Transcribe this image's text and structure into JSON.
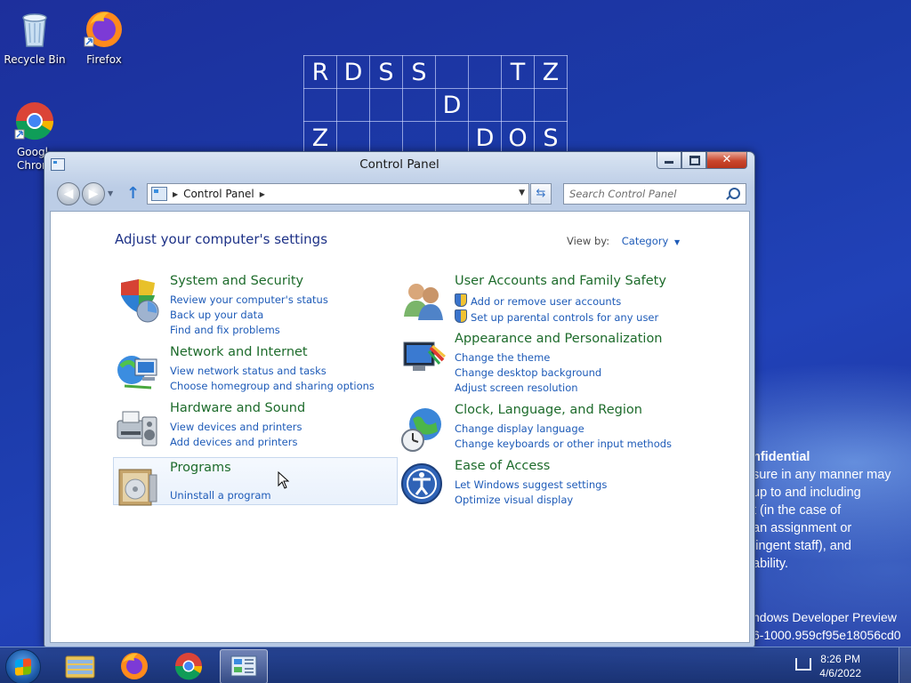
{
  "desktop": {
    "icons": [
      {
        "label": "Recycle Bin",
        "icon": "recycle-bin-icon"
      },
      {
        "label": "Firefox",
        "icon": "firefox-icon"
      },
      {
        "label": "Googl",
        "label2": "Chron",
        "icon": "chrome-icon"
      }
    ],
    "grid_rows": [
      [
        "R",
        "D",
        "S",
        "S",
        "",
        "",
        "T",
        "Z"
      ],
      [
        "",
        "",
        "",
        "",
        "D",
        "",
        "",
        ""
      ],
      [
        "Z",
        "",
        "",
        "",
        "",
        "D",
        "O",
        "S"
      ]
    ],
    "overlay": {
      "title": "nfidential",
      "lines": [
        "sure in any manner may",
        "up to and including",
        "t (in the case of",
        "an assignment or",
        "lingent staff), and",
        "ability."
      ],
      "build1": "ndows Developer Preview",
      "build2": "6-1000.959cf95e18056cd0"
    }
  },
  "window": {
    "title": "Control Panel",
    "address_crumb": "Control Panel",
    "search_placeholder": "Search Control Panel",
    "heading": "Adjust your computer's settings",
    "view_by_label": "View by:",
    "view_by_value": "Category",
    "categories": [
      {
        "title": "System and Security",
        "icon": "system-security-icon",
        "links": [
          "Review your computer's status",
          "Back up your data",
          "Find and fix problems"
        ]
      },
      {
        "title": "Network and Internet",
        "icon": "network-internet-icon",
        "links": [
          "View network status and tasks",
          "Choose homegroup and sharing options"
        ]
      },
      {
        "title": "Hardware and Sound",
        "icon": "hardware-sound-icon",
        "links": [
          "View devices and printers",
          "Add devices and printers"
        ]
      },
      {
        "title": "Programs",
        "icon": "programs-icon",
        "links": [
          "Uninstall a program"
        ]
      },
      {
        "title": "User Accounts and Family Safety",
        "icon": "user-accounts-icon",
        "links": [
          "Add or remove user accounts",
          "Set up parental controls for any user"
        ]
      },
      {
        "title": "Appearance and Personalization",
        "icon": "appearance-icon",
        "links": [
          "Change the theme",
          "Change desktop background",
          "Adjust screen resolution"
        ]
      },
      {
        "title": "Clock, Language, and Region",
        "icon": "clock-language-icon",
        "links": [
          "Change display language",
          "Change keyboards or other input methods"
        ]
      },
      {
        "title": "Ease of Access",
        "icon": "ease-of-access-icon",
        "links": [
          "Let Windows suggest settings",
          "Optimize visual display"
        ]
      }
    ]
  },
  "taskbar": {
    "items": [
      "file-explorer-icon",
      "firefox-icon",
      "chrome-icon",
      "control-panel-icon"
    ],
    "clock_time": "8:26 PM",
    "clock_date": "4/6/2022"
  }
}
